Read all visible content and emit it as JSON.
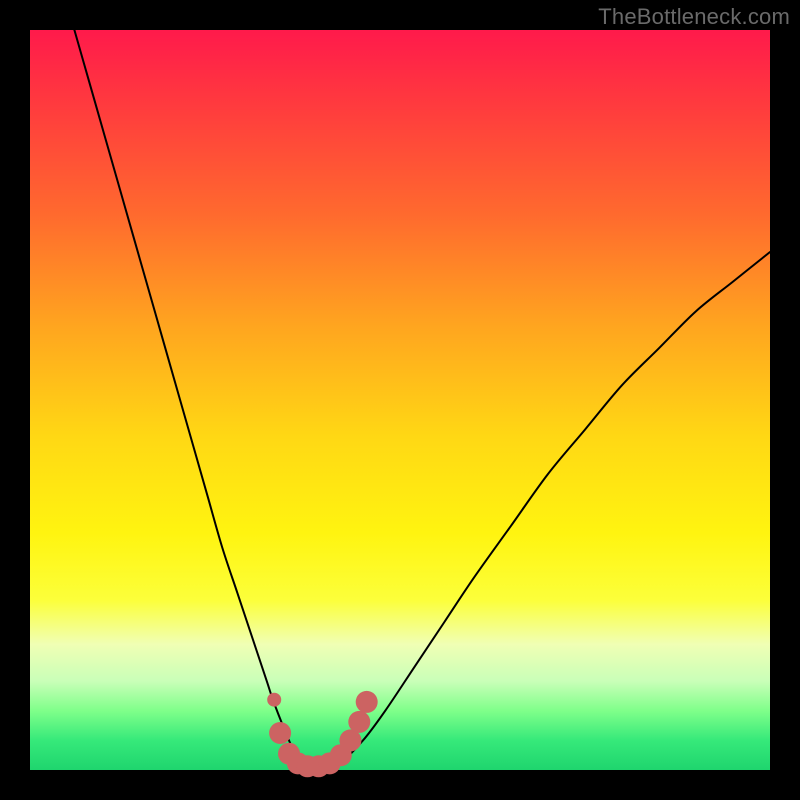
{
  "watermark": "TheBottleneck.com",
  "colors": {
    "frame": "#000000",
    "curve": "#000000",
    "marker_fill": "#cc6362",
    "marker_stroke": "#cc6362"
  },
  "chart_data": {
    "type": "line",
    "title": "",
    "xlabel": "",
    "ylabel": "",
    "xlim": [
      0,
      100
    ],
    "ylim": [
      0,
      100
    ],
    "grid": false,
    "series": [
      {
        "name": "bottleneck-curve",
        "x": [
          6,
          8,
          10,
          12,
          14,
          16,
          18,
          20,
          22,
          24,
          26,
          28,
          30,
          32,
          33,
          35,
          36,
          38,
          40,
          42,
          45,
          48,
          52,
          56,
          60,
          65,
          70,
          75,
          80,
          85,
          90,
          95,
          100
        ],
        "y": [
          100,
          93,
          86,
          79,
          72,
          65,
          58,
          51,
          44,
          37,
          30,
          24,
          18,
          12,
          9,
          4,
          2,
          0,
          0,
          1,
          4,
          8,
          14,
          20,
          26,
          33,
          40,
          46,
          52,
          57,
          62,
          66,
          70
        ]
      }
    ],
    "markers": {
      "name": "highlight-band",
      "points": [
        {
          "x": 33.0,
          "y": 9.5
        },
        {
          "x": 33.8,
          "y": 5.0
        },
        {
          "x": 35.0,
          "y": 2.2
        },
        {
          "x": 36.2,
          "y": 0.9
        },
        {
          "x": 37.5,
          "y": 0.5
        },
        {
          "x": 39.0,
          "y": 0.5
        },
        {
          "x": 40.5,
          "y": 0.9
        },
        {
          "x": 42.0,
          "y": 2.0
        },
        {
          "x": 43.3,
          "y": 4.0
        },
        {
          "x": 44.5,
          "y": 6.5
        },
        {
          "x": 45.5,
          "y": 9.2
        }
      ]
    }
  }
}
